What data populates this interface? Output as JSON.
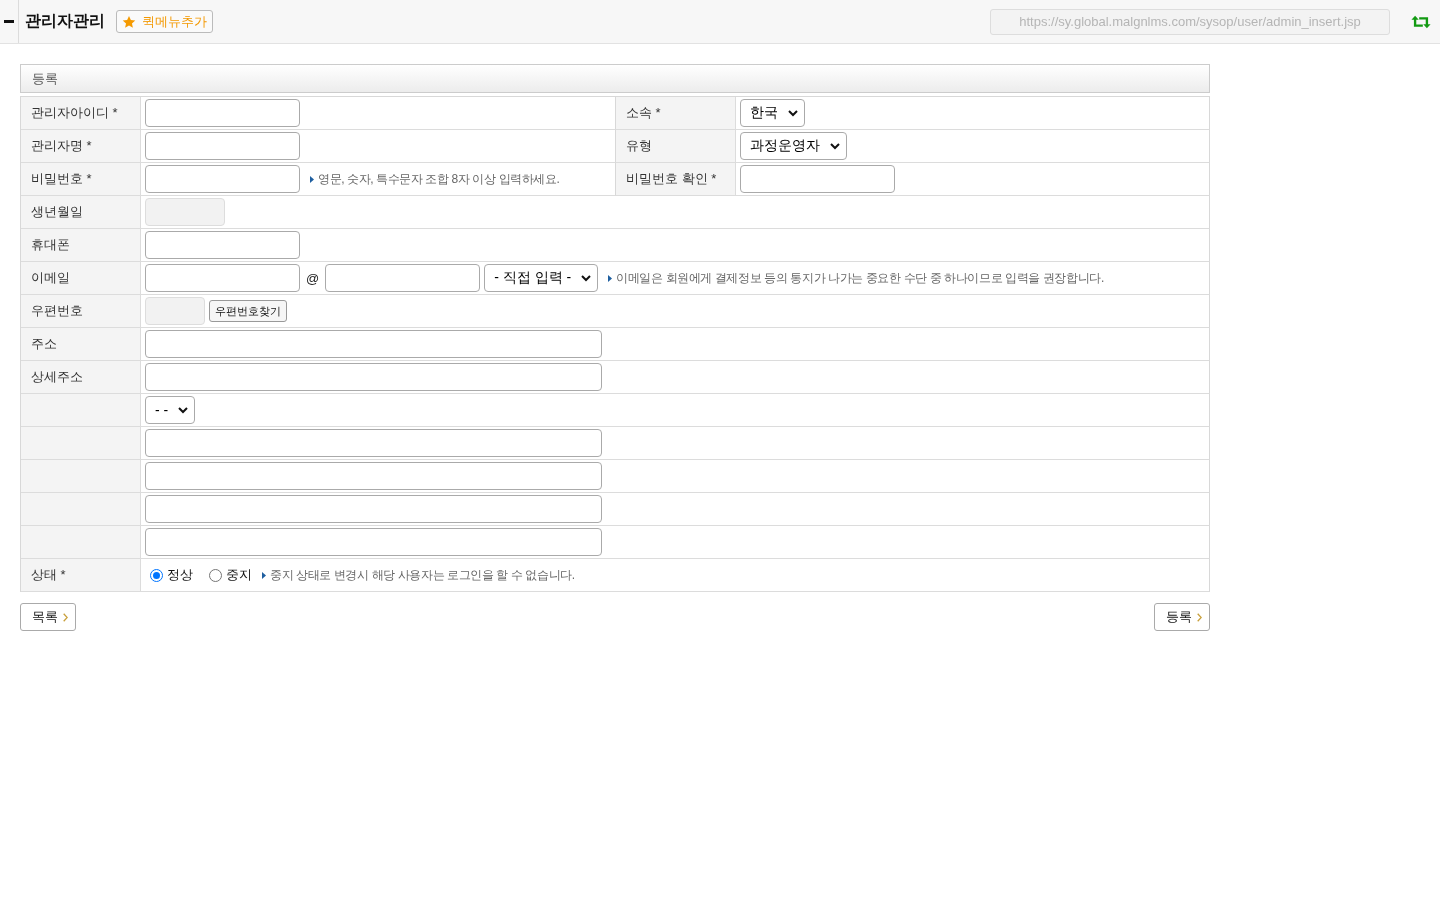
{
  "header": {
    "title": "관리자관리",
    "quick_menu_button": "퀵메뉴추가",
    "url": "https://sy.global.malgnlms.com/sysop/user/admin_insert.jsp"
  },
  "form": {
    "section_title": "등록",
    "rows": [
      {
        "cells": [
          {
            "label": "관리자아이디 *",
            "controls": [
              {
                "kind": "input",
                "disabled": false
              }
            ]
          },
          {
            "label": "소속 *",
            "controls": [
              {
                "kind": "select",
                "value": "한국"
              }
            ]
          }
        ]
      },
      {
        "cells": [
          {
            "label": "관리자명 *",
            "controls": [
              {
                "kind": "input",
                "disabled": false
              }
            ]
          },
          {
            "label": "유형",
            "controls": [
              {
                "kind": "select",
                "value": "과정운영자"
              }
            ]
          }
        ]
      },
      {
        "cells": [
          {
            "label": "비밀번호 *",
            "controls": [
              {
                "kind": "input",
                "disabled": false
              },
              {
                "kind": "hint",
                "text": "영문, 숫자, 특수문자 조합 8자 이상 입력하세요."
              }
            ]
          },
          {
            "label": "비밀번호 확인 *",
            "controls": [
              {
                "kind": "input",
                "disabled": false
              }
            ]
          }
        ]
      },
      {
        "cells": [
          {
            "label": "생년월일",
            "controls": [
              {
                "kind": "smallinput",
                "disabled": true
              }
            ]
          }
        ]
      },
      {
        "cells": [
          {
            "label": "휴대폰",
            "controls": [
              {
                "kind": "input",
                "disabled": false
              }
            ]
          }
        ]
      },
      {
        "cells": [
          {
            "label": "이메일",
            "controls": [
              {
                "kind": "input",
                "disabled": false
              },
              {
                "kind": "text",
                "text": "@"
              },
              {
                "kind": "input",
                "disabled": false
              },
              {
                "kind": "select",
                "value": "- 직접 입력 -"
              },
              {
                "kind": "hint",
                "text": "이메일은 회원에게 결제정보 등의 통지가 나가는 중요한 수단 중 하나이므로 입력을 권장합니다."
              }
            ]
          }
        ]
      },
      {
        "cells": [
          {
            "label": "우편번호",
            "controls": [
              {
                "kind": "tinyinput",
                "disabled": true
              },
              {
                "kind": "button",
                "label": "우편번호찾기"
              }
            ]
          }
        ]
      },
      {
        "cells": [
          {
            "label": "주소",
            "controls": [
              {
                "kind": "wideinput",
                "disabled": false
              }
            ]
          }
        ]
      },
      {
        "cells": [
          {
            "label": "상세주소",
            "controls": [
              {
                "kind": "wideinput",
                "disabled": false
              }
            ]
          }
        ]
      },
      {
        "cells": [
          {
            "controls": [
              {
                "kind": "select",
                "value": "- -"
              }
            ]
          }
        ]
      },
      {
        "cells": [
          {
            "controls": [
              {
                "kind": "wideinput",
                "disabled": false
              }
            ]
          }
        ]
      },
      {
        "cells": [
          {
            "controls": [
              {
                "kind": "wideinput",
                "disabled": false
              }
            ]
          }
        ]
      },
      {
        "cells": [
          {
            "controls": [
              {
                "kind": "wideinput",
                "disabled": false
              }
            ]
          }
        ]
      },
      {
        "cells": [
          {
            "controls": [
              {
                "kind": "wideinput",
                "disabled": false
              }
            ]
          }
        ]
      },
      {
        "cells": [
          {
            "label": "상태 *",
            "controls": [
              {
                "kind": "radio",
                "label": "정상",
                "selected": true
              },
              {
                "kind": "radio",
                "label": "중지",
                "selected": false
              },
              {
                "kind": "hint",
                "text": "중지 상태로 변경시 해당 사용자는 로그인을 할 수 없습니다."
              }
            ]
          }
        ]
      }
    ]
  },
  "buttons": [
    {
      "label": "목록"
    },
    {
      "label": "등록"
    }
  ]
}
